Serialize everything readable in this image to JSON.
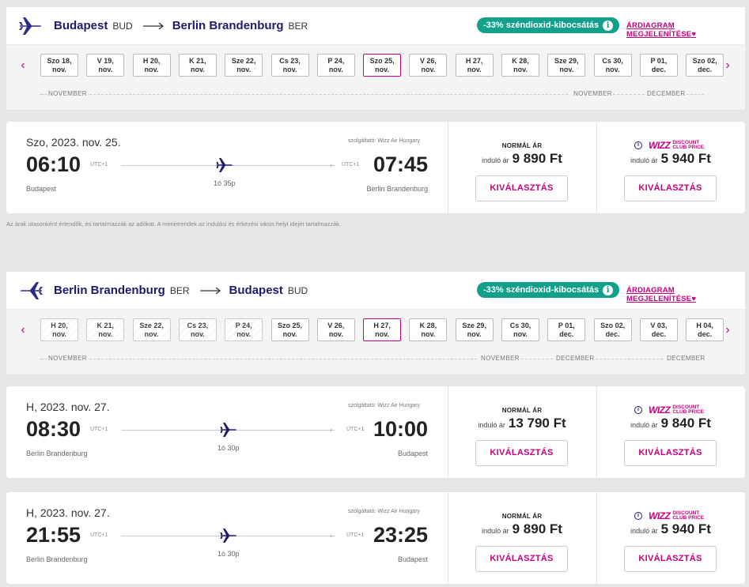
{
  "outbound": {
    "from_city": "Budapest",
    "from_code": "BUD",
    "to_city": "Berlin Brandenburg",
    "to_code": "BER",
    "co2_label": "-33% széndioxid-kibocsátás",
    "fare_chart_link": "ÁRDIAGRAM MEGJELENÍTÉSE",
    "dates": [
      {
        "d": "Szo 18,",
        "m": "nov."
      },
      {
        "d": "V 19,",
        "m": "nov."
      },
      {
        "d": "H 20,",
        "m": "nov."
      },
      {
        "d": "K 21,",
        "m": "nov."
      },
      {
        "d": "Sze 22,",
        "m": "nov."
      },
      {
        "d": "Cs 23,",
        "m": "nov."
      },
      {
        "d": "P 24,",
        "m": "nov."
      },
      {
        "d": "Szo 25,",
        "m": "nov."
      },
      {
        "d": "V 26,",
        "m": "nov."
      },
      {
        "d": "H 27,",
        "m": "nov."
      },
      {
        "d": "K 28,",
        "m": "nov."
      },
      {
        "d": "Sze 29,",
        "m": "nov."
      },
      {
        "d": "Cs 30,",
        "m": "nov."
      },
      {
        "d": "P 01,",
        "m": "dec."
      },
      {
        "d": "Szo 02,",
        "m": "dec."
      }
    ],
    "selected_index": 7,
    "month_labels": {
      "left": "NOVEMBER",
      "right1": "NOVEMBER",
      "right2": "DECEMBER"
    }
  },
  "inbound": {
    "from_city": "Berlin Brandenburg",
    "from_code": "BER",
    "to_city": "Budapest",
    "to_code": "BUD",
    "co2_label": "-33% széndioxid-kibocsátás",
    "fare_chart_link": "ÁRDIAGRAM MEGJELENÍTÉSE",
    "dates": [
      {
        "d": "H 20,",
        "m": "nov."
      },
      {
        "d": "K 21,",
        "m": "nov."
      },
      {
        "d": "Sze 22,",
        "m": "nov."
      },
      {
        "d": "Cs 23,",
        "m": "nov."
      },
      {
        "d": "P 24,",
        "m": "nov."
      },
      {
        "d": "Szo 25,",
        "m": "nov."
      },
      {
        "d": "V 26,",
        "m": "nov."
      },
      {
        "d": "H 27,",
        "m": "nov."
      },
      {
        "d": "K 28,",
        "m": "nov."
      },
      {
        "d": "Sze 29,",
        "m": "nov."
      },
      {
        "d": "Cs 30,",
        "m": "nov."
      },
      {
        "d": "P 01,",
        "m": "dec."
      },
      {
        "d": "Szo 02,",
        "m": "dec."
      },
      {
        "d": "V 03,",
        "m": "dec."
      },
      {
        "d": "H 04,",
        "m": "dec."
      }
    ],
    "selected_index": 7,
    "faded_count": 5,
    "month_labels": {
      "left": "NOVEMBER",
      "right1": "NOVEMBER",
      "right2": "DECEMBER",
      "right3": "DECEMBER"
    }
  },
  "flights": [
    {
      "date": "Szo, 2023. nov. 25.",
      "provider": "szolgáltató: Wizz Air Hungary",
      "dep_time": "06:10",
      "arr_time": "07:45",
      "utc": "UTC+1",
      "duration": "1ó 35p",
      "dep_city": "Budapest",
      "arr_city": "Berlin Brandenburg",
      "normal_label": "NORMÁL ÁR",
      "from_label": "induló ár",
      "normal_price": "9 890 Ft",
      "wdc_price": "5 940 Ft",
      "select": "KIVÁLASZTÁS"
    },
    {
      "date": "H, 2023. nov. 27.",
      "provider": "szolgáltató: Wizz Air Hungary",
      "dep_time": "08:30",
      "arr_time": "10:00",
      "utc": "UTC+1",
      "duration": "1ó 30p",
      "dep_city": "Berlin Brandenburg",
      "arr_city": "Budapest",
      "normal_label": "NORMÁL ÁR",
      "from_label": "induló ár",
      "normal_price": "13 790 Ft",
      "wdc_price": "9 840 Ft",
      "select": "KIVÁLASZTÁS"
    },
    {
      "date": "H, 2023. nov. 27.",
      "provider": "szolgáltató: Wizz Air Hungary",
      "dep_time": "21:55",
      "arr_time": "23:25",
      "utc": "UTC+1",
      "duration": "1ó 30p",
      "dep_city": "Berlin Brandenburg",
      "arr_city": "Budapest",
      "normal_label": "NORMÁL ÁR",
      "from_label": "induló ár",
      "normal_price": "9 890 Ft",
      "wdc_price": "5 940 Ft",
      "select": "KIVÁLASZTÁS"
    }
  ],
  "wdc_badge": {
    "wizz": "WIZZ",
    "line1": "DISCOUNT",
    "line2": "CLUB PRICE"
  },
  "disclaimer": "Az árak utasonként értendők, és tartalmazzák az adókat. A menetrendek az indulási és érkezési város helyi idejét tartalmazzák.",
  "colors": {
    "brand_navy": "#1e1b6e",
    "brand_magenta": "#c6007e",
    "co2_green": "#13a08a"
  }
}
